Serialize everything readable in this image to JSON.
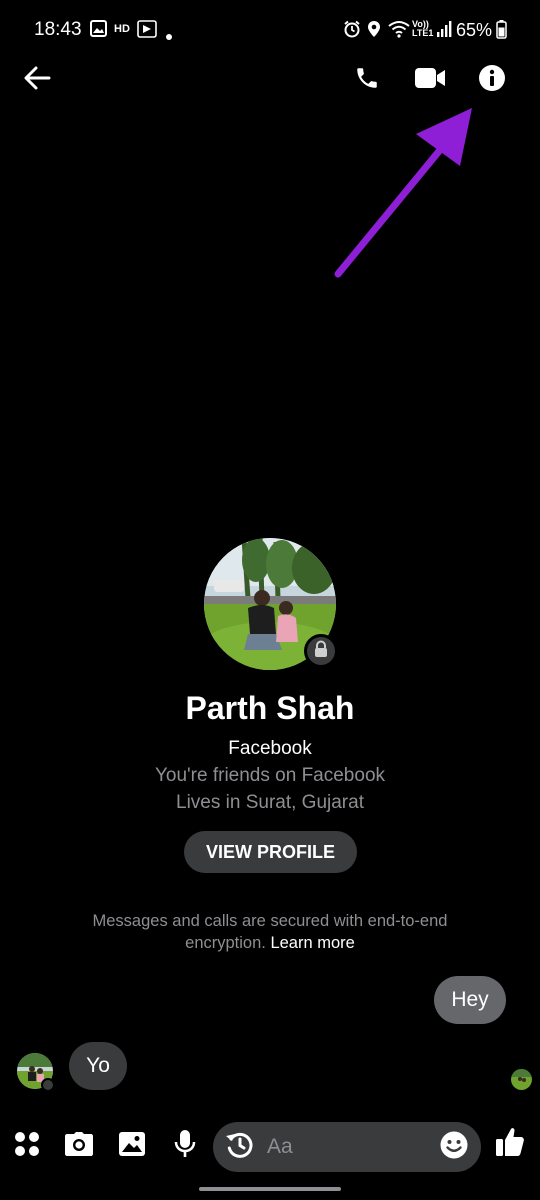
{
  "status_bar": {
    "time": "18:43",
    "battery": "65%",
    "network_label": "Vo)) LTE1",
    "hd_label": "HD",
    "icons": [
      "gallery-icon",
      "hd-icon",
      "app-icon",
      "dot-icon",
      "alarm-icon",
      "location-icon",
      "wifi-icon",
      "signal-icon",
      "battery-icon"
    ]
  },
  "header": {
    "icons": [
      "back-arrow-icon",
      "phone-icon",
      "video-camera-icon",
      "info-icon"
    ]
  },
  "annotation": {
    "color": "#8e1fd6",
    "points_to": "info-icon"
  },
  "profile": {
    "name": "Parth Shah",
    "platform": "Facebook",
    "friends_text": "You're friends on Facebook",
    "location_text": "Lives in Surat, Gujarat",
    "view_profile_label": "VIEW PROFILE"
  },
  "encryption": {
    "text": "Messages and calls are secured with end-to-end encryption.",
    "link": "Learn more"
  },
  "messages": [
    {
      "direction": "outgoing",
      "text": "Hey"
    },
    {
      "direction": "incoming",
      "text": "Yo"
    }
  ],
  "composer": {
    "placeholder": "Aa",
    "icons": [
      "menu-dots-icon",
      "camera-icon",
      "image-icon",
      "microphone-icon",
      "history-icon",
      "emoji-icon",
      "thumbs-up-icon"
    ]
  },
  "colors": {
    "background": "#000000",
    "bubble_outgoing": "#65676b",
    "bubble_incoming": "#3a3b3c",
    "muted_text": "#8e8e93"
  }
}
